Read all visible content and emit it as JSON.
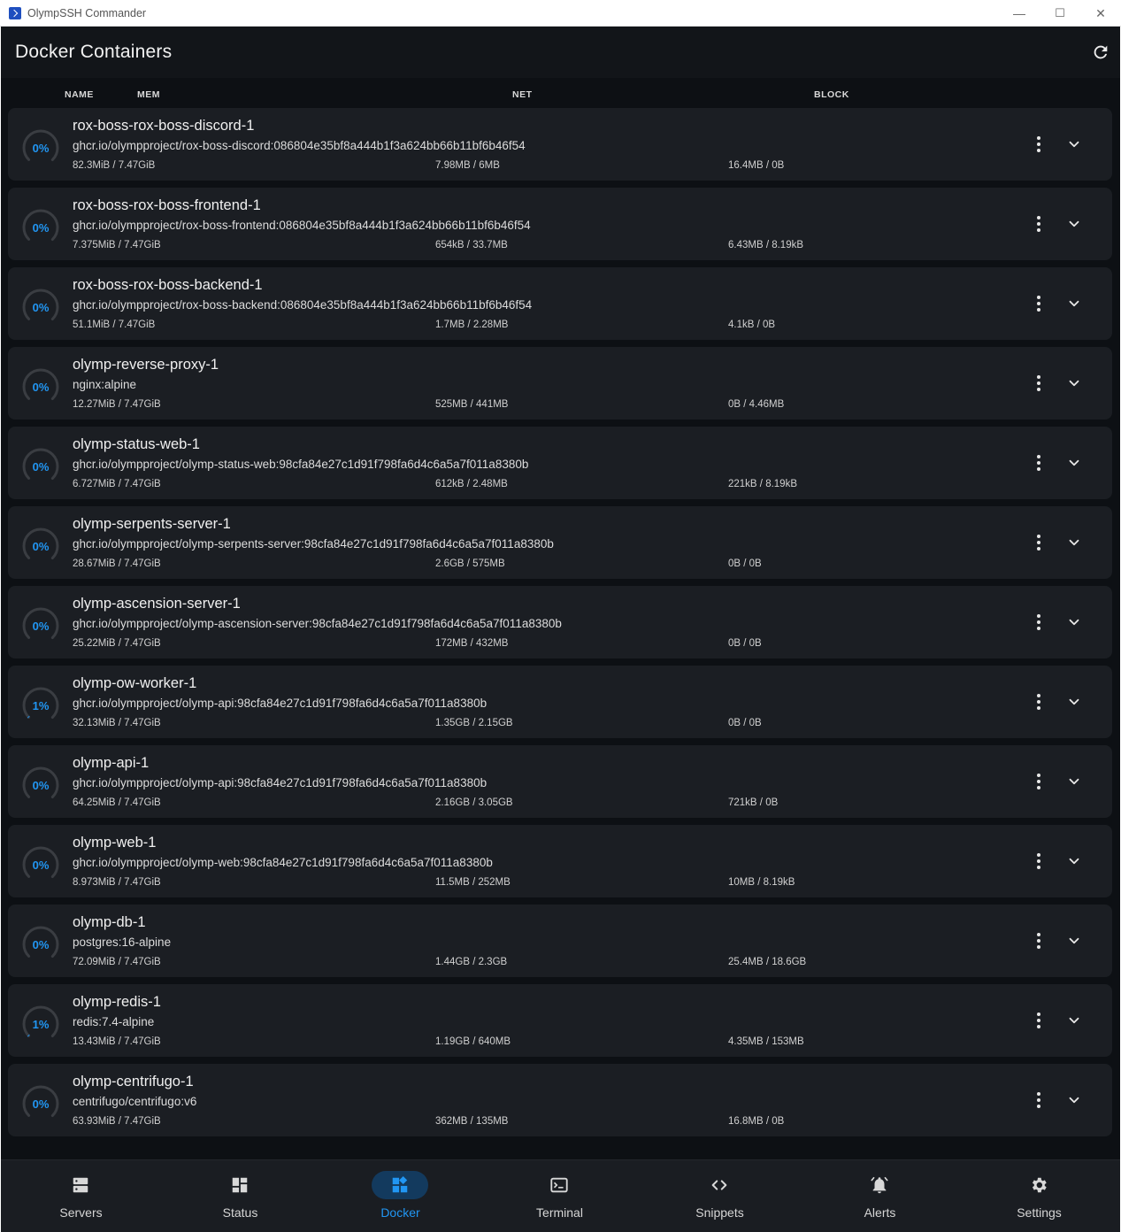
{
  "window": {
    "title": "OlympSSH Commander",
    "minimize": "—",
    "maximize": "☐",
    "close": "✕"
  },
  "header": {
    "title": "Docker Containers"
  },
  "columns": {
    "name": "NAME",
    "mem": "MEM",
    "net": "NET",
    "block": "BLOCK"
  },
  "containers": [
    {
      "cpu": "0%",
      "cpu_value": 0,
      "name": "rox-boss-rox-boss-discord-1",
      "image": "ghcr.io/olympproject/rox-boss-discord:086804e35bf8a444b1f3a624bb66b11bf6b46f54",
      "mem": "82.3MiB / 7.47GiB",
      "net": "7.98MB / 6MB",
      "block": "16.4MB / 0B"
    },
    {
      "cpu": "0%",
      "cpu_value": 0,
      "name": "rox-boss-rox-boss-frontend-1",
      "image": "ghcr.io/olympproject/rox-boss-frontend:086804e35bf8a444b1f3a624bb66b11bf6b46f54",
      "mem": "7.375MiB / 7.47GiB",
      "net": "654kB / 33.7MB",
      "block": "6.43MB / 8.19kB"
    },
    {
      "cpu": "0%",
      "cpu_value": 0,
      "name": "rox-boss-rox-boss-backend-1",
      "image": "ghcr.io/olympproject/rox-boss-backend:086804e35bf8a444b1f3a624bb66b11bf6b46f54",
      "mem": "51.1MiB / 7.47GiB",
      "net": "1.7MB / 2.28MB",
      "block": "4.1kB / 0B"
    },
    {
      "cpu": "0%",
      "cpu_value": 0,
      "name": "olymp-reverse-proxy-1",
      "image": "nginx:alpine",
      "mem": "12.27MiB / 7.47GiB",
      "net": "525MB / 441MB",
      "block": "0B / 4.46MB"
    },
    {
      "cpu": "0%",
      "cpu_value": 0,
      "name": "olymp-status-web-1",
      "image": "ghcr.io/olympproject/olymp-status-web:98cfa84e27c1d91f798fa6d4c6a5a7f011a8380b",
      "mem": "6.727MiB / 7.47GiB",
      "net": "612kB / 2.48MB",
      "block": "221kB / 8.19kB"
    },
    {
      "cpu": "0%",
      "cpu_value": 0,
      "name": "olymp-serpents-server-1",
      "image": "ghcr.io/olympproject/olymp-serpents-server:98cfa84e27c1d91f798fa6d4c6a5a7f011a8380b",
      "mem": "28.67MiB / 7.47GiB",
      "net": "2.6GB / 575MB",
      "block": "0B / 0B"
    },
    {
      "cpu": "0%",
      "cpu_value": 0,
      "name": "olymp-ascension-server-1",
      "image": "ghcr.io/olympproject/olymp-ascension-server:98cfa84e27c1d91f798fa6d4c6a5a7f011a8380b",
      "mem": "25.22MiB / 7.47GiB",
      "net": "172MB / 432MB",
      "block": "0B / 0B"
    },
    {
      "cpu": "1%",
      "cpu_value": 1,
      "name": "olymp-ow-worker-1",
      "image": "ghcr.io/olympproject/olymp-api:98cfa84e27c1d91f798fa6d4c6a5a7f011a8380b",
      "mem": "32.13MiB / 7.47GiB",
      "net": "1.35GB / 2.15GB",
      "block": "0B / 0B"
    },
    {
      "cpu": "0%",
      "cpu_value": 0,
      "name": "olymp-api-1",
      "image": "ghcr.io/olympproject/olymp-api:98cfa84e27c1d91f798fa6d4c6a5a7f011a8380b",
      "mem": "64.25MiB / 7.47GiB",
      "net": "2.16GB / 3.05GB",
      "block": "721kB / 0B"
    },
    {
      "cpu": "0%",
      "cpu_value": 0,
      "name": "olymp-web-1",
      "image": "ghcr.io/olympproject/olymp-web:98cfa84e27c1d91f798fa6d4c6a5a7f011a8380b",
      "mem": "8.973MiB / 7.47GiB",
      "net": "11.5MB / 252MB",
      "block": "10MB / 8.19kB"
    },
    {
      "cpu": "0%",
      "cpu_value": 0,
      "name": "olymp-db-1",
      "image": "postgres:16-alpine",
      "mem": "72.09MiB / 7.47GiB",
      "net": "1.44GB / 2.3GB",
      "block": "25.4MB / 18.6GB"
    },
    {
      "cpu": "1%",
      "cpu_value": 1,
      "name": "olymp-redis-1",
      "image": "redis:7.4-alpine",
      "mem": "13.43MiB / 7.47GiB",
      "net": "1.19GB / 640MB",
      "block": "4.35MB / 153MB"
    },
    {
      "cpu": "0%",
      "cpu_value": 0,
      "name": "olymp-centrifugo-1",
      "image": "centrifugo/centrifugo:v6",
      "mem": "63.93MiB / 7.47GiB",
      "net": "362MB / 135MB",
      "block": "16.8MB / 0B"
    }
  ],
  "nav": [
    {
      "label": "Servers",
      "icon": "servers-icon",
      "active": false
    },
    {
      "label": "Status",
      "icon": "dashboard-icon",
      "active": false
    },
    {
      "label": "Docker",
      "icon": "docker-widgets-icon",
      "active": true
    },
    {
      "label": "Terminal",
      "icon": "terminal-icon",
      "active": false
    },
    {
      "label": "Snippets",
      "icon": "code-icon",
      "active": false
    },
    {
      "label": "Alerts",
      "icon": "bell-icon",
      "active": false
    },
    {
      "label": "Settings",
      "icon": "gear-icon",
      "active": false
    }
  ],
  "colors": {
    "accent": "#2196f3",
    "background": "#0d1014",
    "card": "#1b1e23",
    "nav_background": "#1a1d22",
    "active_pill": "#133a5e",
    "gauge_track": "#3a3d42"
  }
}
